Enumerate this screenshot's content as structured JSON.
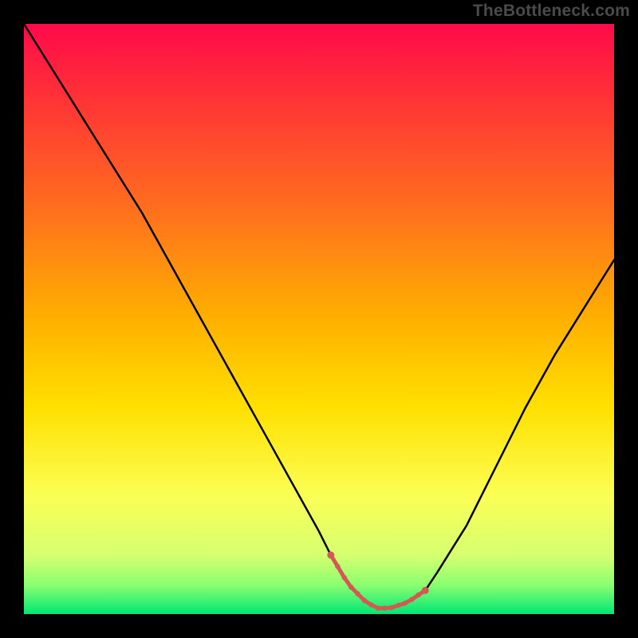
{
  "watermark": "TheBottleneck.com",
  "colors": {
    "bg": "#000000",
    "watermark": "#4a4a4a",
    "curve": "#000000",
    "highlight": "#d45955",
    "gradient_stops": [
      {
        "offset": 0.0,
        "color": "#ff0a4a"
      },
      {
        "offset": 0.1,
        "color": "#ff2a3a"
      },
      {
        "offset": 0.3,
        "color": "#ff6a20"
      },
      {
        "offset": 0.5,
        "color": "#ffb000"
      },
      {
        "offset": 0.65,
        "color": "#ffe000"
      },
      {
        "offset": 0.8,
        "color": "#fbff55"
      },
      {
        "offset": 0.9,
        "color": "#d6ff70"
      },
      {
        "offset": 0.95,
        "color": "#8cff70"
      },
      {
        "offset": 1.0,
        "color": "#00e676"
      }
    ]
  },
  "chart_data": {
    "type": "line",
    "title": "",
    "xlabel": "",
    "ylabel": "",
    "xlim": [
      0,
      100
    ],
    "ylim": [
      0,
      100
    ],
    "series": [
      {
        "name": "bottleneck-curve",
        "x": [
          0,
          5,
          10,
          15,
          20,
          25,
          30,
          35,
          40,
          45,
          50,
          52,
          55,
          58,
          60,
          62,
          65,
          68,
          70,
          75,
          80,
          85,
          90,
          95,
          100
        ],
        "values": [
          100,
          92,
          84,
          76,
          68,
          59,
          50,
          41,
          32,
          23,
          14,
          10,
          5,
          2,
          1,
          1,
          2,
          4,
          7,
          15,
          25,
          35,
          44,
          52,
          60
        ]
      }
    ],
    "annotations": [
      {
        "name": "optimal-range-highlight",
        "x_range": [
          52,
          68
        ],
        "style": "red-dots-underline"
      }
    ]
  }
}
